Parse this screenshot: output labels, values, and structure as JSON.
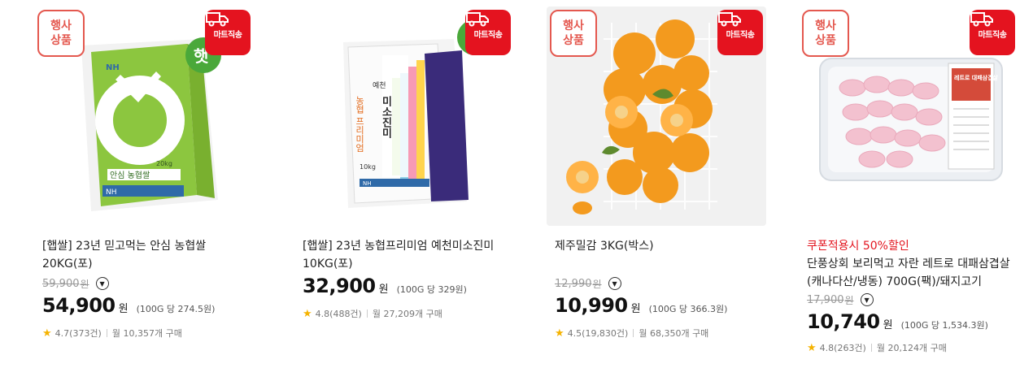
{
  "badges": {
    "event_line1": "행사",
    "event_line2": "상품",
    "mart": "마트직송"
  },
  "products": [
    {
      "name_line1": "[햅쌀] 23년 믿고먹는 안심 농협쌀",
      "name_line2": "20KG(포)",
      "original_price": "59,900",
      "won_label": "원",
      "price": "54,900",
      "unit_price": "(100G 당 274.5원)",
      "rating": "4.7(373건)",
      "monthly": "월 10,357개 구매",
      "package_text": "안심 농협쌀",
      "package_weight": "20kg",
      "package_brand": "NH",
      "package_sticker": "햇"
    },
    {
      "name_line1": "[햅쌀] 23년 농협프리미엄 예천미소진미",
      "name_line2": "10KG(포)",
      "won_label": "원",
      "price": "32,900",
      "unit_price": "(100G 당 329원)",
      "rating": "4.8(488건)",
      "monthly": "월 27,209개 구매",
      "package_text": "미소진미",
      "package_sub": "농협 프리미엄",
      "package_region": "예천",
      "package_weight": "10kg",
      "package_brand": "NH",
      "package_sticker": "햇"
    },
    {
      "name_line1": "제주밀감 3KG(박스)",
      "original_price": "12,990",
      "won_label": "원",
      "price": "10,990",
      "unit_price": "(100G 당 366.3원)",
      "rating": "4.5(19,830건)",
      "monthly": "월 68,350개 구매"
    },
    {
      "promo": "쿠폰적용시 50%할인",
      "name_line1": "단풍상회 보리먹고 자란 레트로 대패삼겹살",
      "name_line2": "(캐나다산/냉동) 700G(팩)/돼지고기",
      "original_price": "17,900",
      "won_label": "원",
      "price": "10,740",
      "unit_price": "(100G 당 1,534.3원)",
      "rating": "4.8(263건)",
      "monthly": "월 20,124개 구매",
      "package_label": "레트로 대패삼겹살"
    }
  ],
  "colors": {
    "accent_red": "#e4131f",
    "event_red": "#e4584f",
    "rice_green": "#8cc63f",
    "orange": "#f39a1e"
  }
}
